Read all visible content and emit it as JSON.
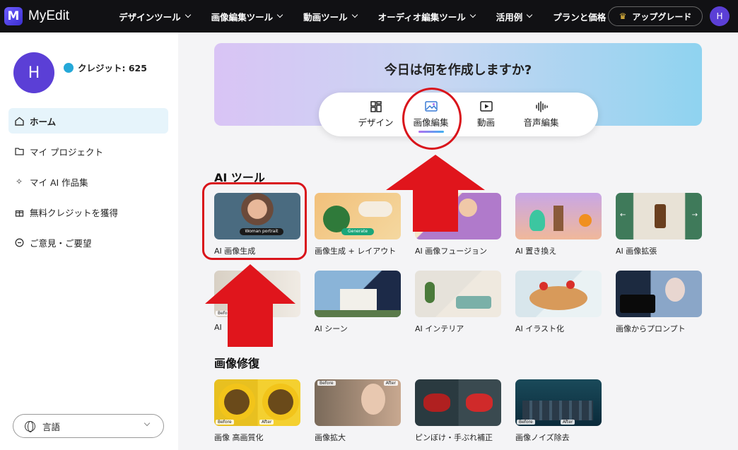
{
  "app": {
    "logo_letter": "M",
    "name": "MyEdit"
  },
  "nav": {
    "items": [
      "デザインツール",
      "画像編集ツール",
      "動画ツール",
      "オーディオ編集ツール",
      "活用例",
      "プランと価格"
    ],
    "upgrade_label": "アップグレード",
    "avatar_letter": "H"
  },
  "sidebar": {
    "avatar_letter": "H",
    "credits_label": "クレジット: 625",
    "items": [
      {
        "label": "ホーム",
        "icon": "home-icon",
        "active": true
      },
      {
        "label": "マイ プロジェクト",
        "icon": "folder-icon"
      },
      {
        "label": "マイ AI 作品集",
        "icon": "sparkle-icon"
      },
      {
        "label": "無料クレジットを獲得",
        "icon": "gift-icon"
      },
      {
        "label": "ご意見・ご要望",
        "icon": "feedback-icon"
      }
    ],
    "language_label": "言語"
  },
  "hero": {
    "title": "今日は何を作成しますか?",
    "tabs": [
      {
        "label": "デザイン",
        "icon": "design-grid-icon"
      },
      {
        "label": "画像編集",
        "icon": "image-edit-icon",
        "active": true
      },
      {
        "label": "動画",
        "icon": "video-play-icon"
      },
      {
        "label": "音声編集",
        "icon": "audio-wave-icon"
      }
    ]
  },
  "ai_tools": {
    "title": "AI ツール",
    "cards": [
      {
        "label": "AI 画像生成",
        "thumb_text": "Woman portrait"
      },
      {
        "label": "画像生成 + レイアウト",
        "thumb_text": "Generate"
      },
      {
        "label": "AI 画像フュージョン"
      },
      {
        "label": "AI 置き換え"
      },
      {
        "label": "AI 画像拡張"
      },
      {
        "label": "AI",
        "before": "Before"
      },
      {
        "label": "AI シーン"
      },
      {
        "label": "AI インテリア"
      },
      {
        "label": "AI イラスト化"
      },
      {
        "label": "画像からプロンプト"
      }
    ]
  },
  "restore": {
    "title": "画像修復",
    "cards": [
      {
        "label": "画像 高画質化",
        "before": "Before",
        "after": "After"
      },
      {
        "label": "画像拡大",
        "before": "Before",
        "after": "After"
      },
      {
        "label": "ピンぼけ・手ぶれ補正"
      },
      {
        "label": "画像ノイズ除去",
        "before": "Before",
        "after": "After"
      }
    ]
  },
  "colors": {
    "annotation": "#d9141b",
    "accent": "#5b3fd6",
    "topbar": "#111114"
  }
}
